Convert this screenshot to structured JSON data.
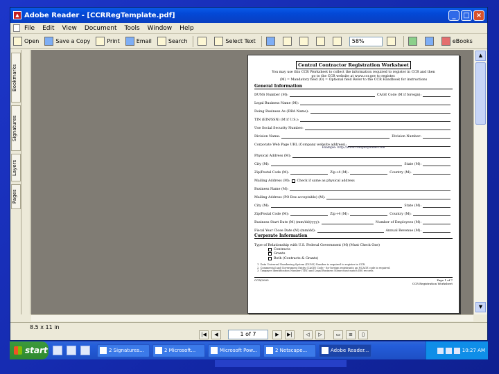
{
  "window": {
    "title": "Adobe Reader - [CCRRegTemplate.pdf]"
  },
  "menu": [
    "File",
    "Edit",
    "View",
    "Document",
    "Tools",
    "Window",
    "Help"
  ],
  "toolbar": {
    "open": "Open",
    "save_copy": "Save a Copy",
    "print": "Print",
    "email": "Email",
    "search": "Search",
    "select_text": "Select Text",
    "zoom": "58%",
    "ebooks": "eBooks"
  },
  "side_tabs": [
    "Bookmarks",
    "Signatures",
    "Layers",
    "Pages"
  ],
  "status": {
    "page_size": "8.5 x 11 in",
    "page_field": "1 of 7"
  },
  "form": {
    "title": "Central Contractor Registration Worksheet",
    "intro": [
      "You may use this CCR Worksheet to collect the information required to register in CCR and then",
      "go to the CCR website at www.ccr.gov to register.",
      "(M) = Mandatory field   (O) = Optional field   Refer to the CCR Handbook for instructions"
    ],
    "section_general": "General Information",
    "rows": [
      {
        "label": "DUNS Number (M):",
        "label2": "CAGE Code (M if foreign):"
      },
      {
        "label": "Legal Business Name (M):"
      },
      {
        "label": "Doing Business As (DBA Name):"
      },
      {
        "label": "TIN (EIN/SSN) (M if U.S.):"
      },
      {
        "label": "Use Social Security Number:"
      },
      {
        "label": "Division Name:",
        "label2": "Division Number:"
      },
      {
        "label": "Corporate Web Page URL (Company website address):",
        "sub": "Example: http://www.companyname.com"
      },
      {
        "label": "Physical Address (M):"
      },
      {
        "label": "City (M):",
        "label2": "State (M):"
      },
      {
        "label": "Zip/Postal Code (M):",
        "label2": "Zip+4 (M):",
        "label3": "Country (M):"
      },
      {
        "label": "Mailing Address (M):",
        "check": "Check if same as physical address"
      },
      {
        "label": "Business Name (M):"
      },
      {
        "label": "Mailing Address (PO Box acceptable) (M):"
      },
      {
        "label": "City (M):",
        "label2": "State (M):"
      },
      {
        "label": "Zip/Postal Code (M):",
        "label2": "Zip+4 (M):",
        "label3": "Country (M):"
      },
      {
        "label": "Business Start Date (M) (mm/dd/yyyy):",
        "label2": "Number of Employees (M):"
      },
      {
        "label": "Fiscal Year Close Date (M) (mm/dd):",
        "label2": "Annual Revenue (M):"
      }
    ],
    "section_corporate": "Corporate Information",
    "relationship_label": "Type of Relationship with U.S. Federal Government (M) (Must Check One)",
    "relationship_options": [
      "Contracts",
      "Grants",
      "Both (Contracts & Grants)"
    ],
    "notes": [
      "1. Data Universal Numbering System (DUNS) Number is required to register in CCR.",
      "2. Commercial and Government Entity (CAGE) Code - for foreign registrants an NCAGE code is required.",
      "3. Taxpayer Identification Number (TIN) and Legal Business Name must match IRS records."
    ],
    "footer_left": "CCR/2005",
    "footer_right": "Page 1 of 7\nCCR Registration Worksheet"
  },
  "taskbar": {
    "start": "start",
    "tasks": [
      "2 Signatures...",
      "2 Microsoft...",
      "Microsoft Pow...",
      "2 Netscape...",
      "Adobe Reader..."
    ],
    "clock": "10:27 AM"
  }
}
